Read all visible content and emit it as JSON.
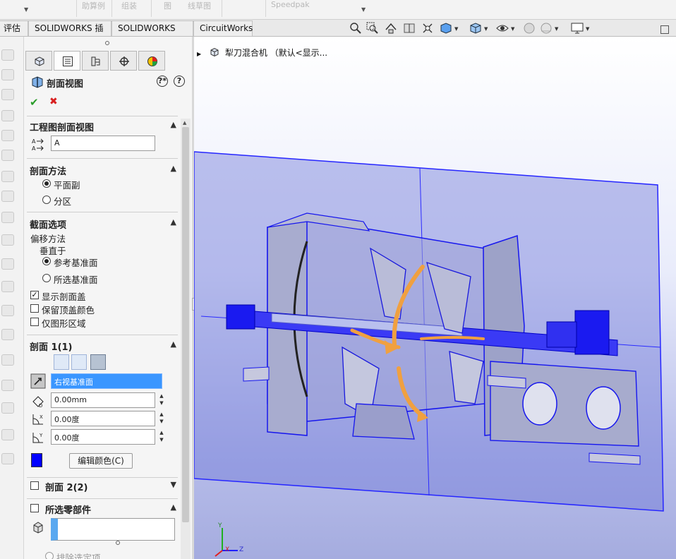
{
  "ribbon": {
    "ghost_labels": [
      "助算例",
      "组装",
      "图",
      "线草图",
      "Speedpak"
    ]
  },
  "tabs": [
    {
      "label": "评估"
    },
    {
      "label": "SOLIDWORKS 插件"
    },
    {
      "label": "SOLIDWORKS MBD"
    },
    {
      "label": "CircuitWorks"
    }
  ],
  "property_manager": {
    "title": "剖面视图",
    "help_labels": [
      "?*",
      "?"
    ],
    "groups": {
      "drawing_section": {
        "title": "工程图剖面视图",
        "name_value": "A"
      },
      "method": {
        "title": "剖面方法",
        "options": [
          "平面副",
          "分区"
        ],
        "selected": 0
      },
      "options": {
        "title": "截面选项",
        "offset_label": "偏移方法",
        "normal_label": "垂直于",
        "ref_options": [
          "参考基准面",
          "所选基准面"
        ],
        "ref_selected": 0,
        "checks": [
          {
            "label": "显示剖面盖",
            "checked": true
          },
          {
            "label": "保留顶盖颜色",
            "checked": false
          },
          {
            "label": "仅图形区域",
            "checked": false
          }
        ]
      },
      "section1": {
        "title": "剖面 1(1)",
        "plane_value": "右视基准面",
        "distance_value": "0.00mm",
        "angle_x_value": "0.00度",
        "angle_y_value": "0.00度",
        "color": "#0000ff",
        "edit_color_label": "编辑颜色(C)"
      },
      "section2": {
        "title": "剖面 2(2)",
        "checked": false
      },
      "selected_parts": {
        "title": "所选零部件",
        "checked": false,
        "exclude_label": "排除选定项"
      }
    }
  },
  "viewport": {
    "tree_label": "犁刀混合机 （默认<显示...",
    "axis_labels": {
      "x": "X",
      "y": "Y",
      "z": "Z"
    },
    "colors": {
      "section_blue": "#0000ff",
      "model_gray": "#8e93c9",
      "arrow": "#f0a040"
    }
  },
  "icons": [
    "part-icon",
    "property-icon",
    "config-icon",
    "target-icon",
    "appearance-icon",
    "section-view-icon",
    "ok-icon",
    "cancel-icon",
    "plane-icon",
    "distance-icon",
    "angle-x-icon",
    "angle-y-icon",
    "component-icon",
    "pin-icon"
  ]
}
